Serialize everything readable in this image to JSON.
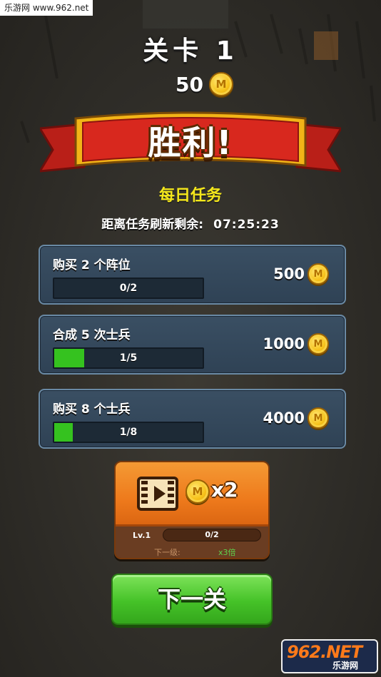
{
  "watermark": {
    "site": "乐游网 www.962.net"
  },
  "header": {
    "level_title": "关卡 1",
    "coins": "50",
    "coin_glyph": "M"
  },
  "banner": {
    "text": "胜利!"
  },
  "daily": {
    "title": "每日任务",
    "refresh_label": "距离任务刷新剩余:",
    "refresh_time": "07:25:23"
  },
  "tasks": [
    {
      "title": "购买 2 个阵位",
      "progress_text": "0/2",
      "progress": 0.0,
      "reward": "500"
    },
    {
      "title": "合成 5 次士兵",
      "progress_text": "1/5",
      "progress": 0.2,
      "reward": "1000"
    },
    {
      "title": "购买 8 个士兵",
      "progress_text": "1/8",
      "progress": 0.125,
      "reward": "4000"
    }
  ],
  "video_bonus": {
    "multiplier": "x2",
    "level_label": "Lv.1",
    "level_progress": "0/2",
    "next_label": "下一级:",
    "next_value": "x3倍"
  },
  "next_button": {
    "label": "下一关"
  },
  "logo": {
    "brand": "962.NET",
    "subtitle": "乐游网"
  },
  "colors": {
    "task_title_yellow": "#f5e71b",
    "progress_green": "#35c21f",
    "banner_red": "#d8281e",
    "button_green": "#45c228",
    "button_orange": "#ee7a1c"
  }
}
